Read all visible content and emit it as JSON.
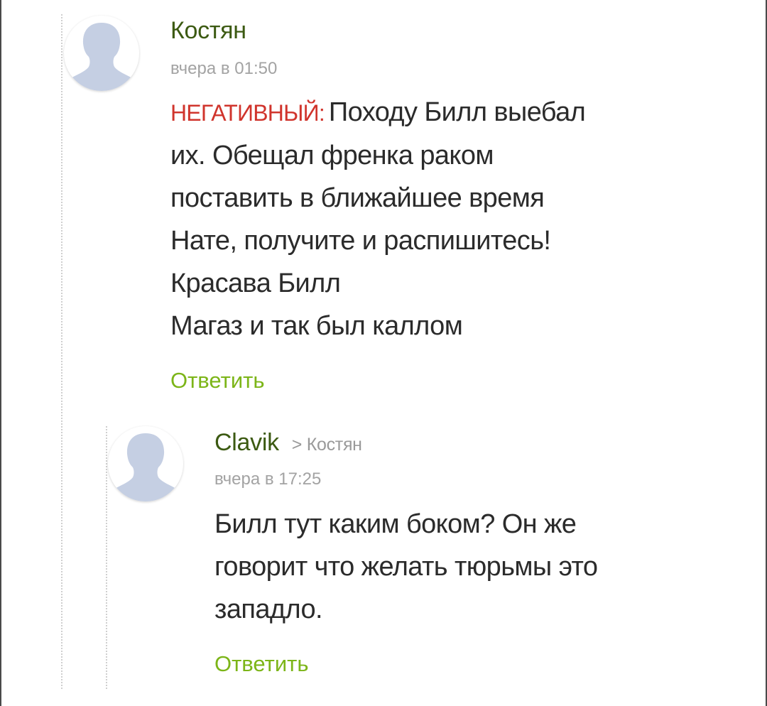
{
  "comments": [
    {
      "author": "Костян",
      "time": "вчера в 01:50",
      "tag": "НЕГАТИВНЫЙ:",
      "lines": [
        "Походу Билл выебал",
        "их. Обещал френка раком",
        "поставить в ближайшее время",
        "Нате, получите и распишитесь!",
        "Красава Билл",
        "Магаз и так был каллом"
      ],
      "reply_label": "Ответить"
    },
    {
      "author": "Clavik",
      "reply_to": "> Костян",
      "time": "вчера в 17:25",
      "lines": [
        "Билл тут каким боком? Он же",
        "говорит что желать тюрьмы это",
        "западло."
      ],
      "reply_label": "Ответить"
    }
  ],
  "colors": {
    "author": "#3c5a12",
    "negative_tag": "#d0342c",
    "reply_link": "#7cb518",
    "avatar_silhouette": "#c5cfe3"
  },
  "icons": {
    "avatar": "default-user-silhouette-icon"
  }
}
